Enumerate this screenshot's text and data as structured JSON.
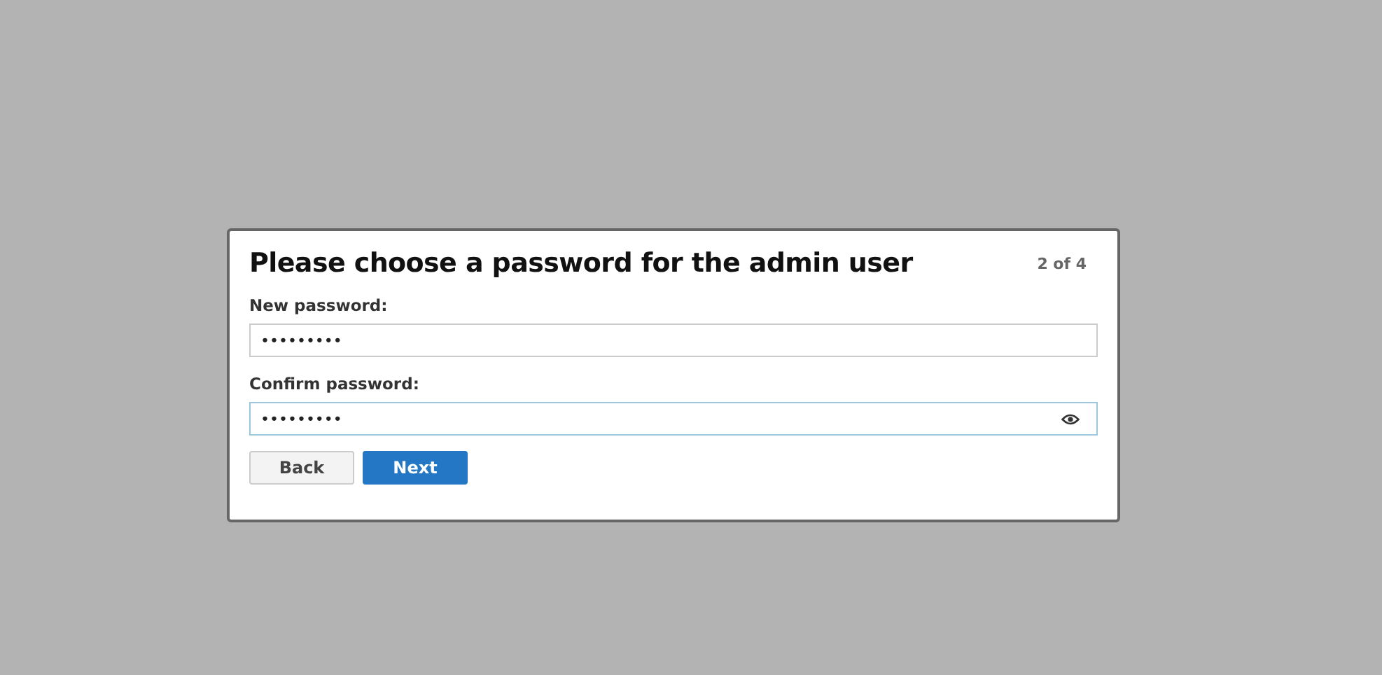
{
  "dialog": {
    "title": "Please choose a password for the admin user",
    "step": "2 of 4",
    "fields": [
      {
        "label": "New password:",
        "value": "•••••••••",
        "focused": false,
        "reveal_icon": false
      },
      {
        "label": "Confirm password:",
        "value": "•••••••••",
        "focused": true,
        "reveal_icon": true
      }
    ],
    "buttons": [
      {
        "label": "Back",
        "kind": "secondary"
      },
      {
        "label": "Next",
        "kind": "primary"
      }
    ]
  }
}
